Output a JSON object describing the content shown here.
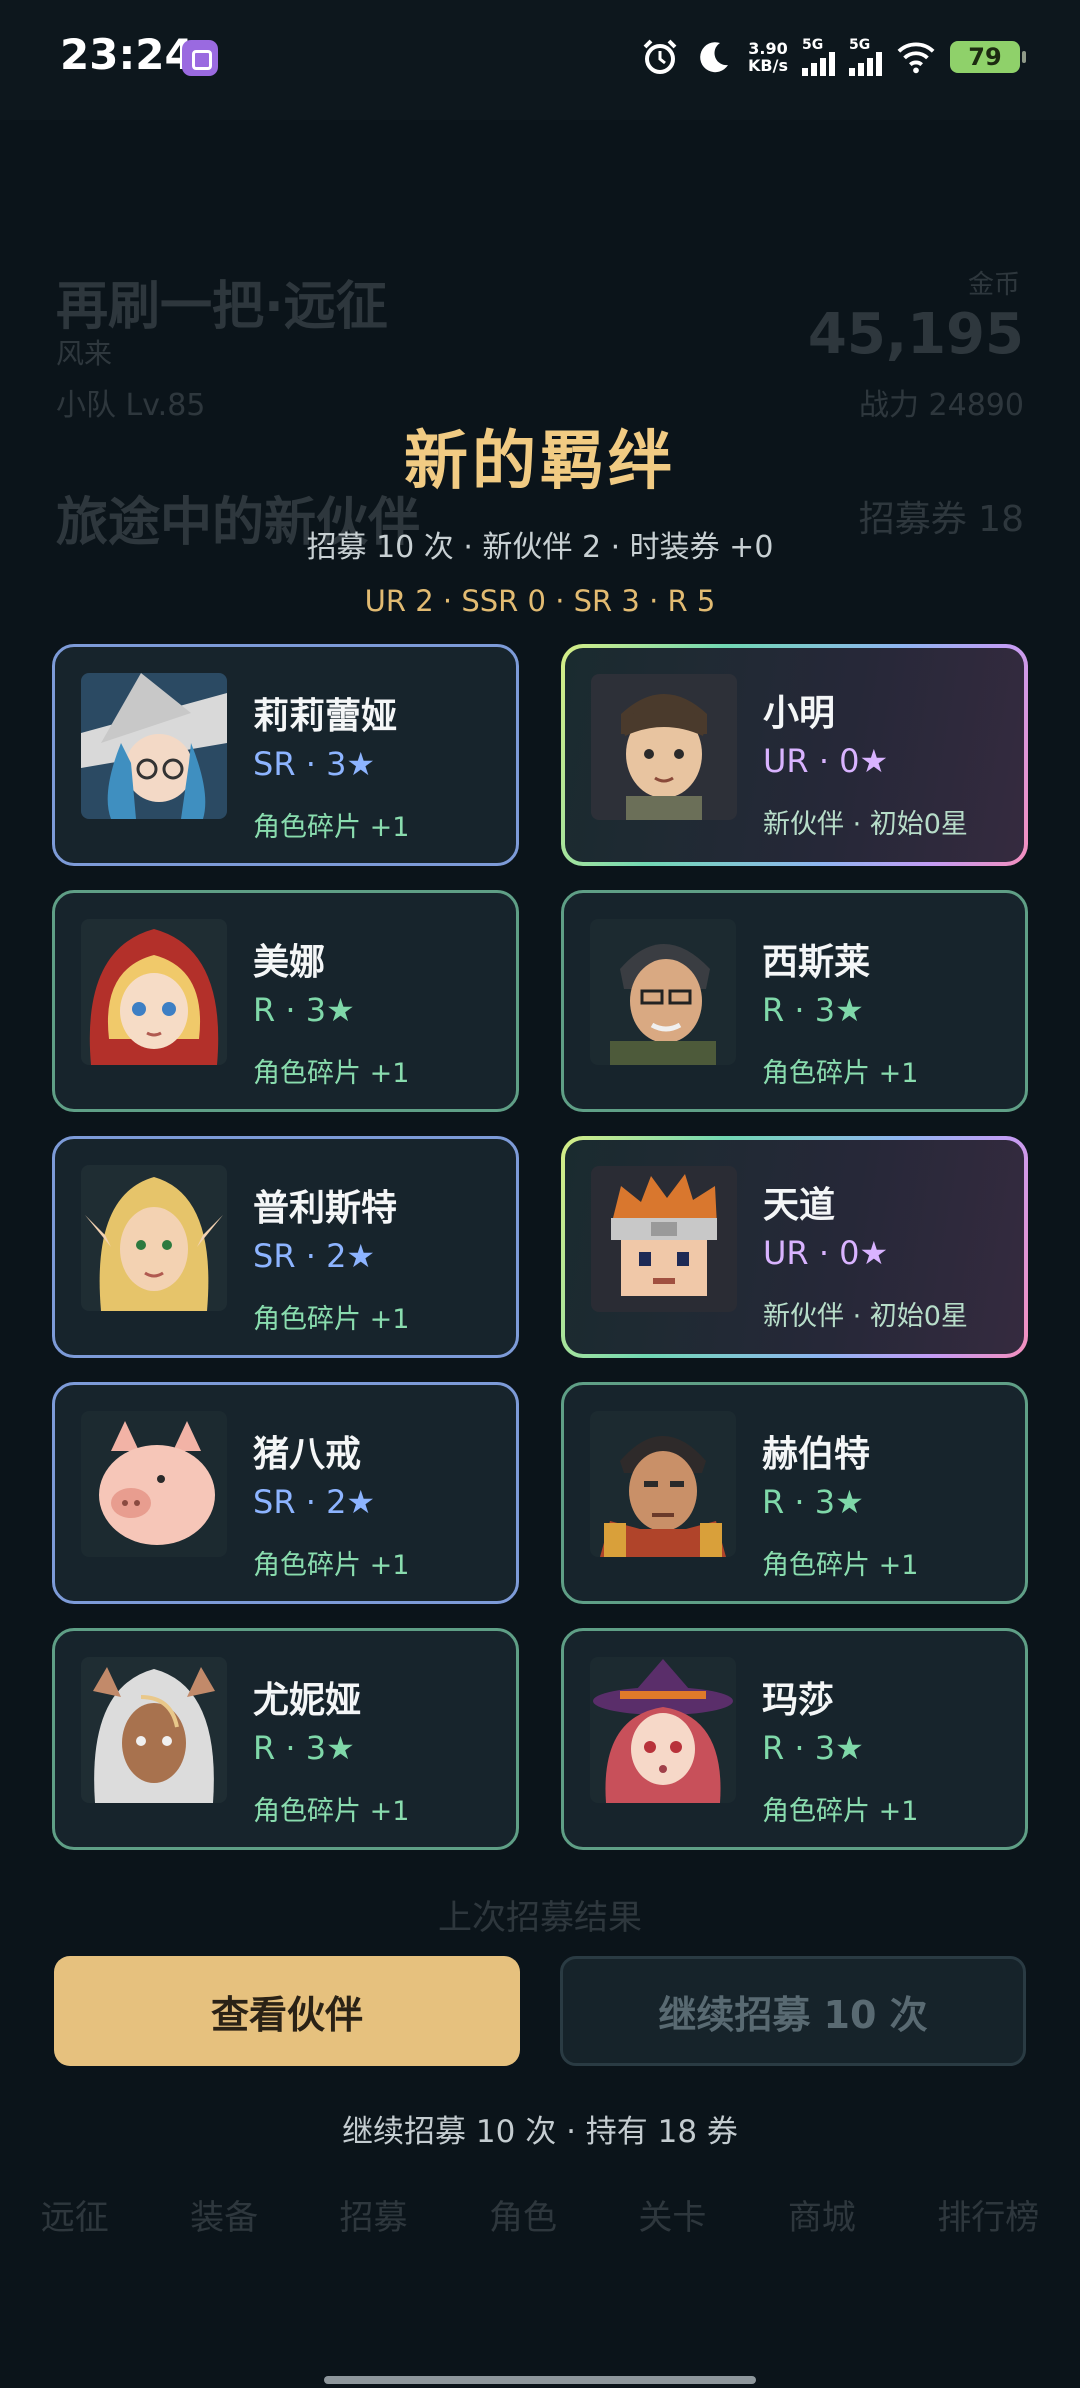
{
  "status_bar": {
    "time": "23:24",
    "app_icon": "app-icon",
    "net_speed_value": "3.90",
    "net_speed_unit": "KB/s",
    "sim1": "5G",
    "sim2": "5G",
    "battery": "79"
  },
  "background": {
    "title": "再刷一把·远征",
    "subtitle": "风来",
    "team_level": "小队 Lv.85",
    "gold_label": "金币",
    "gold": "45,195",
    "power": "战力 24890",
    "section_title": "旅途中的新伙伴",
    "tickets": "招募券 18",
    "last_result": "上次招募结果",
    "nav": [
      "远征",
      "装备",
      "招募",
      "角色",
      "关卡",
      "商城",
      "排行榜"
    ]
  },
  "modal": {
    "title": "新的羁绊",
    "summary": "招募 10 次 · 新伙伴 2 · 时装券 +0",
    "rarity_summary": "UR 2 · SSR 0 · SR 3 · R 5",
    "cards": [
      {
        "name": "莉莉蕾娅",
        "rank": "SR · 3★",
        "note": "角色碎片 +1",
        "rarity": "sr",
        "portrait": "witch"
      },
      {
        "name": "小明",
        "rank": "UR · 0★",
        "note": "新伙伴 · 初始0星",
        "rarity": "ur",
        "portrait": "boy"
      },
      {
        "name": "美娜",
        "rank": "R · 3★",
        "note": "角色碎片 +1",
        "rarity": "r",
        "portrait": "hood-girl"
      },
      {
        "name": "西斯莱",
        "rank": "R · 3★",
        "note": "角色碎片 +1",
        "rarity": "r",
        "portrait": "glasses-man"
      },
      {
        "name": "普利斯特",
        "rank": "SR · 2★",
        "note": "角色碎片 +1",
        "rarity": "sr",
        "portrait": "elf"
      },
      {
        "name": "天道",
        "rank": "UR · 0★",
        "note": "新伙伴 · 初始0星",
        "rarity": "ur",
        "portrait": "ninja"
      },
      {
        "name": "猪八戒",
        "rank": "SR · 2★",
        "note": "角色碎片 +1",
        "rarity": "sr",
        "portrait": "pig"
      },
      {
        "name": "赫伯特",
        "rank": "R · 3★",
        "note": "角色碎片 +1",
        "rarity": "r",
        "portrait": "armored-man"
      },
      {
        "name": "尤妮娅",
        "rank": "R · 3★",
        "note": "角色碎片 +1",
        "rarity": "r",
        "portrait": "white-hair-girl"
      },
      {
        "name": "玛莎",
        "rank": "R · 3★",
        "note": "角色碎片 +1",
        "rarity": "r",
        "portrait": "hat-girl"
      }
    ],
    "view_button": "查看伙伴",
    "continue_button": "继续招募 10 次",
    "footer_note": "继续招募 10 次 · 持有 18 券"
  },
  "colors": {
    "title_gold": "#f1cb83",
    "sr_border": "#7d9bd8",
    "r_border": "#5f9f86",
    "button_gold": "#e6c17e"
  }
}
